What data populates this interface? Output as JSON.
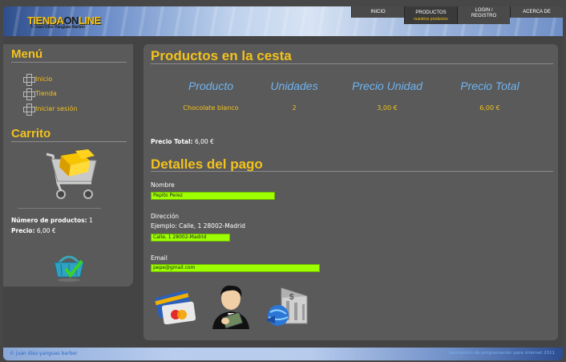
{
  "header": {
    "logo_main": "TIENDA",
    "logo_on": "ON",
    "logo_line": "LINE",
    "logo_sub": "© Juan Díez-Yanguas Barber"
  },
  "nav": {
    "inicio": "INICIO",
    "productos": "PRODUCTOS",
    "productos_sub": "nuestros productos",
    "login_1": "LOGIN /",
    "login_2": "REGISTRO",
    "acerca": "ACERCA DE"
  },
  "sidebar": {
    "menu_title": "Menú",
    "items": [
      {
        "label": "Inicio"
      },
      {
        "label": "Tienda"
      },
      {
        "label": "Iniciar sesión"
      }
    ],
    "cart_title": "Carrito",
    "num_products_label": "Número de productos:",
    "num_products_value": "1",
    "price_label": "Precio:",
    "price_value": "6,00 €"
  },
  "main": {
    "cart_title": "Productos en la cesta",
    "columns": [
      "Producto",
      "Unidades",
      "Precio Unidad",
      "Precio Total"
    ],
    "rows": [
      {
        "product": "Chocolate blanco",
        "units": "2",
        "unit_price": "3,00 €",
        "total": "6,00 €"
      }
    ],
    "total_label": "Precio Total:",
    "total_value": "6,00 €",
    "payment_title": "Detalles del pago",
    "name_label": "Nombre",
    "name_value": "Pepito Perez",
    "address_label": "Dirección",
    "address_example": "Ejemplo: Calle, 1 28002-Madrid",
    "address_value": "Calle, 1 28002-Madrid",
    "email_label": "Email",
    "email_value": "pepe@gmail.com"
  },
  "footer": {
    "left": "©   juan díez-yanguas barber",
    "right": "laboratorio de programación para internet   2011"
  },
  "colors": {
    "accent": "#f3c21c",
    "header_blue": "#6fb4f0",
    "field_green": "#9dff00"
  }
}
